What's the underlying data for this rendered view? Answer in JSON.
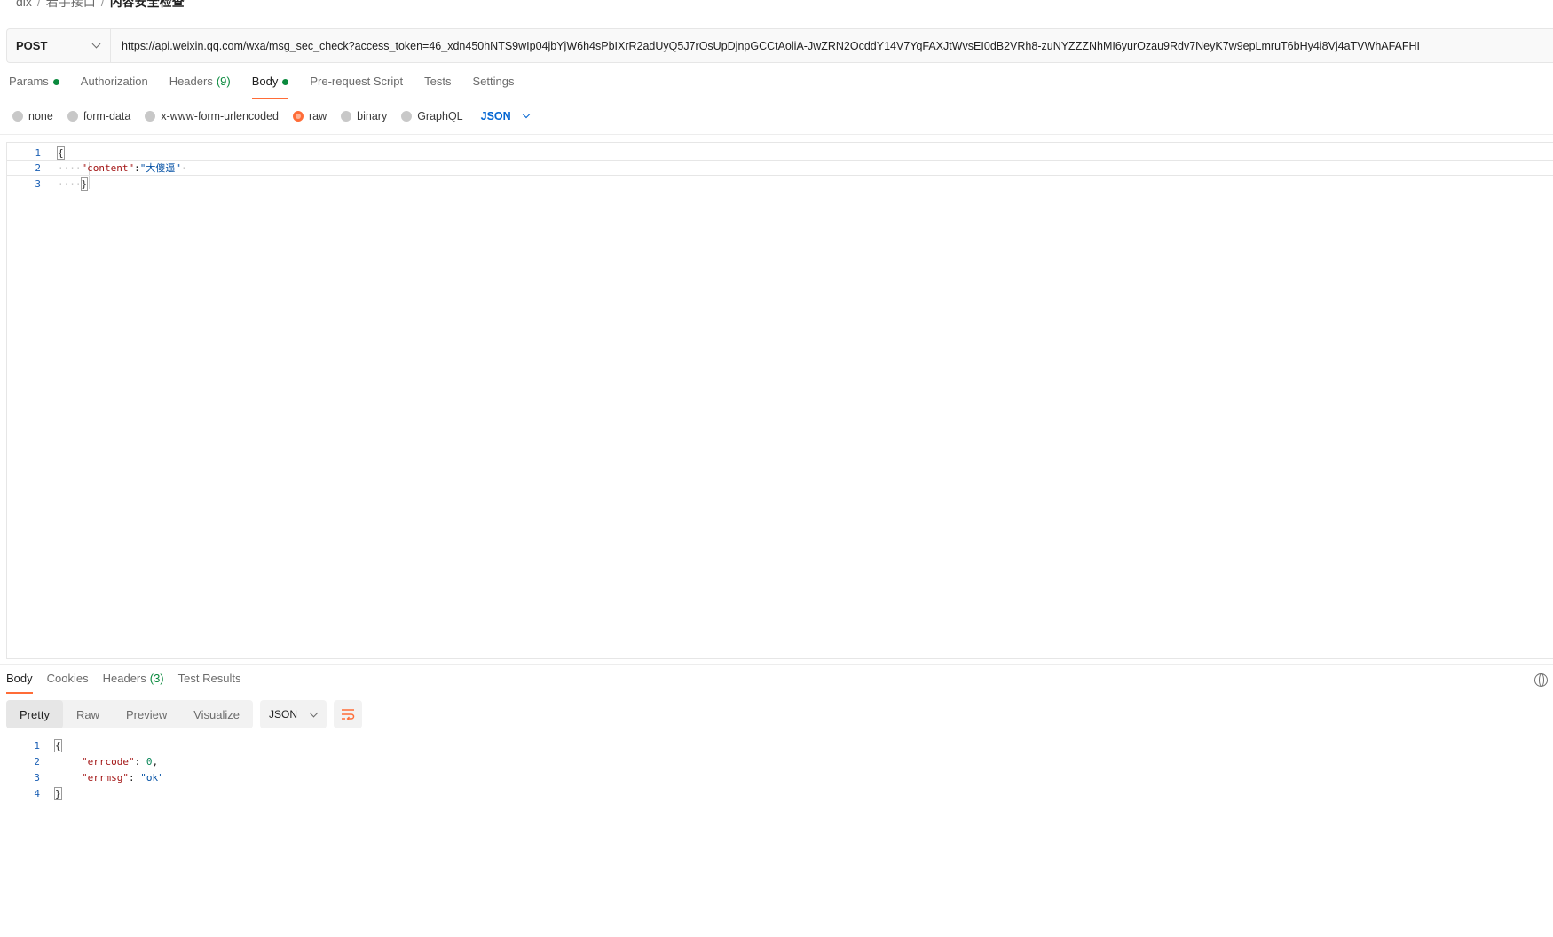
{
  "breadcrumb": {
    "items": [
      "dix",
      "若手接口"
    ],
    "current": "内容安全检查"
  },
  "request": {
    "method": "POST",
    "url": "https://api.weixin.qq.com/wxa/msg_sec_check?access_token=46_xdn450hNTS9wIp04jbYjW6h4sPbIXrR2adUyQ5J7rOsUpDjnpGCCtAoliA-JwZRN2OcddY14V7YqFAXJtWvsEI0dB2VRh8-zuNYZZZNhMI6yurOzau9Rdv7NeyK7w9epLmruT6bHy4i8Vj4aTVWhAFAFHI"
  },
  "request_tabs": [
    {
      "label": "Params",
      "dot": true
    },
    {
      "label": "Authorization"
    },
    {
      "label": "Headers",
      "count": "(9)"
    },
    {
      "label": "Body",
      "dot": true,
      "active": true
    },
    {
      "label": "Pre-request Script"
    },
    {
      "label": "Tests"
    },
    {
      "label": "Settings"
    }
  ],
  "body_options": {
    "modes": [
      "none",
      "form-data",
      "x-www-form-urlencoded",
      "raw",
      "binary",
      "GraphQL"
    ],
    "selected": "raw",
    "language": "JSON"
  },
  "request_body": {
    "line_numbers": [
      "1",
      "2",
      "3"
    ],
    "open_brace": "{",
    "key": "\"content\"",
    "colon": ":",
    "value": "\"大傻逼\"",
    "close_brace": "}"
  },
  "response_tabs": [
    {
      "label": "Body",
      "active": true
    },
    {
      "label": "Cookies"
    },
    {
      "label": "Headers",
      "count": "(3)"
    },
    {
      "label": "Test Results"
    }
  ],
  "response_view": {
    "modes": [
      "Pretty",
      "Raw",
      "Preview",
      "Visualize"
    ],
    "selected": "Pretty",
    "format": "JSON"
  },
  "response_body": {
    "line_numbers": [
      "1",
      "2",
      "3",
      "4"
    ],
    "open_brace": "{",
    "errcode_key": "\"errcode\"",
    "errcode_value": "0",
    "errmsg_key": "\"errmsg\"",
    "errmsg_value": "\"ok\"",
    "close_brace": "}"
  },
  "colors": {
    "accent": "#ff6c37",
    "status_green": "#0b8a3e",
    "link_blue": "#0265d2"
  },
  "icons": [
    "chevron-down-icon",
    "globe-icon",
    "wrap-lines-icon"
  ]
}
